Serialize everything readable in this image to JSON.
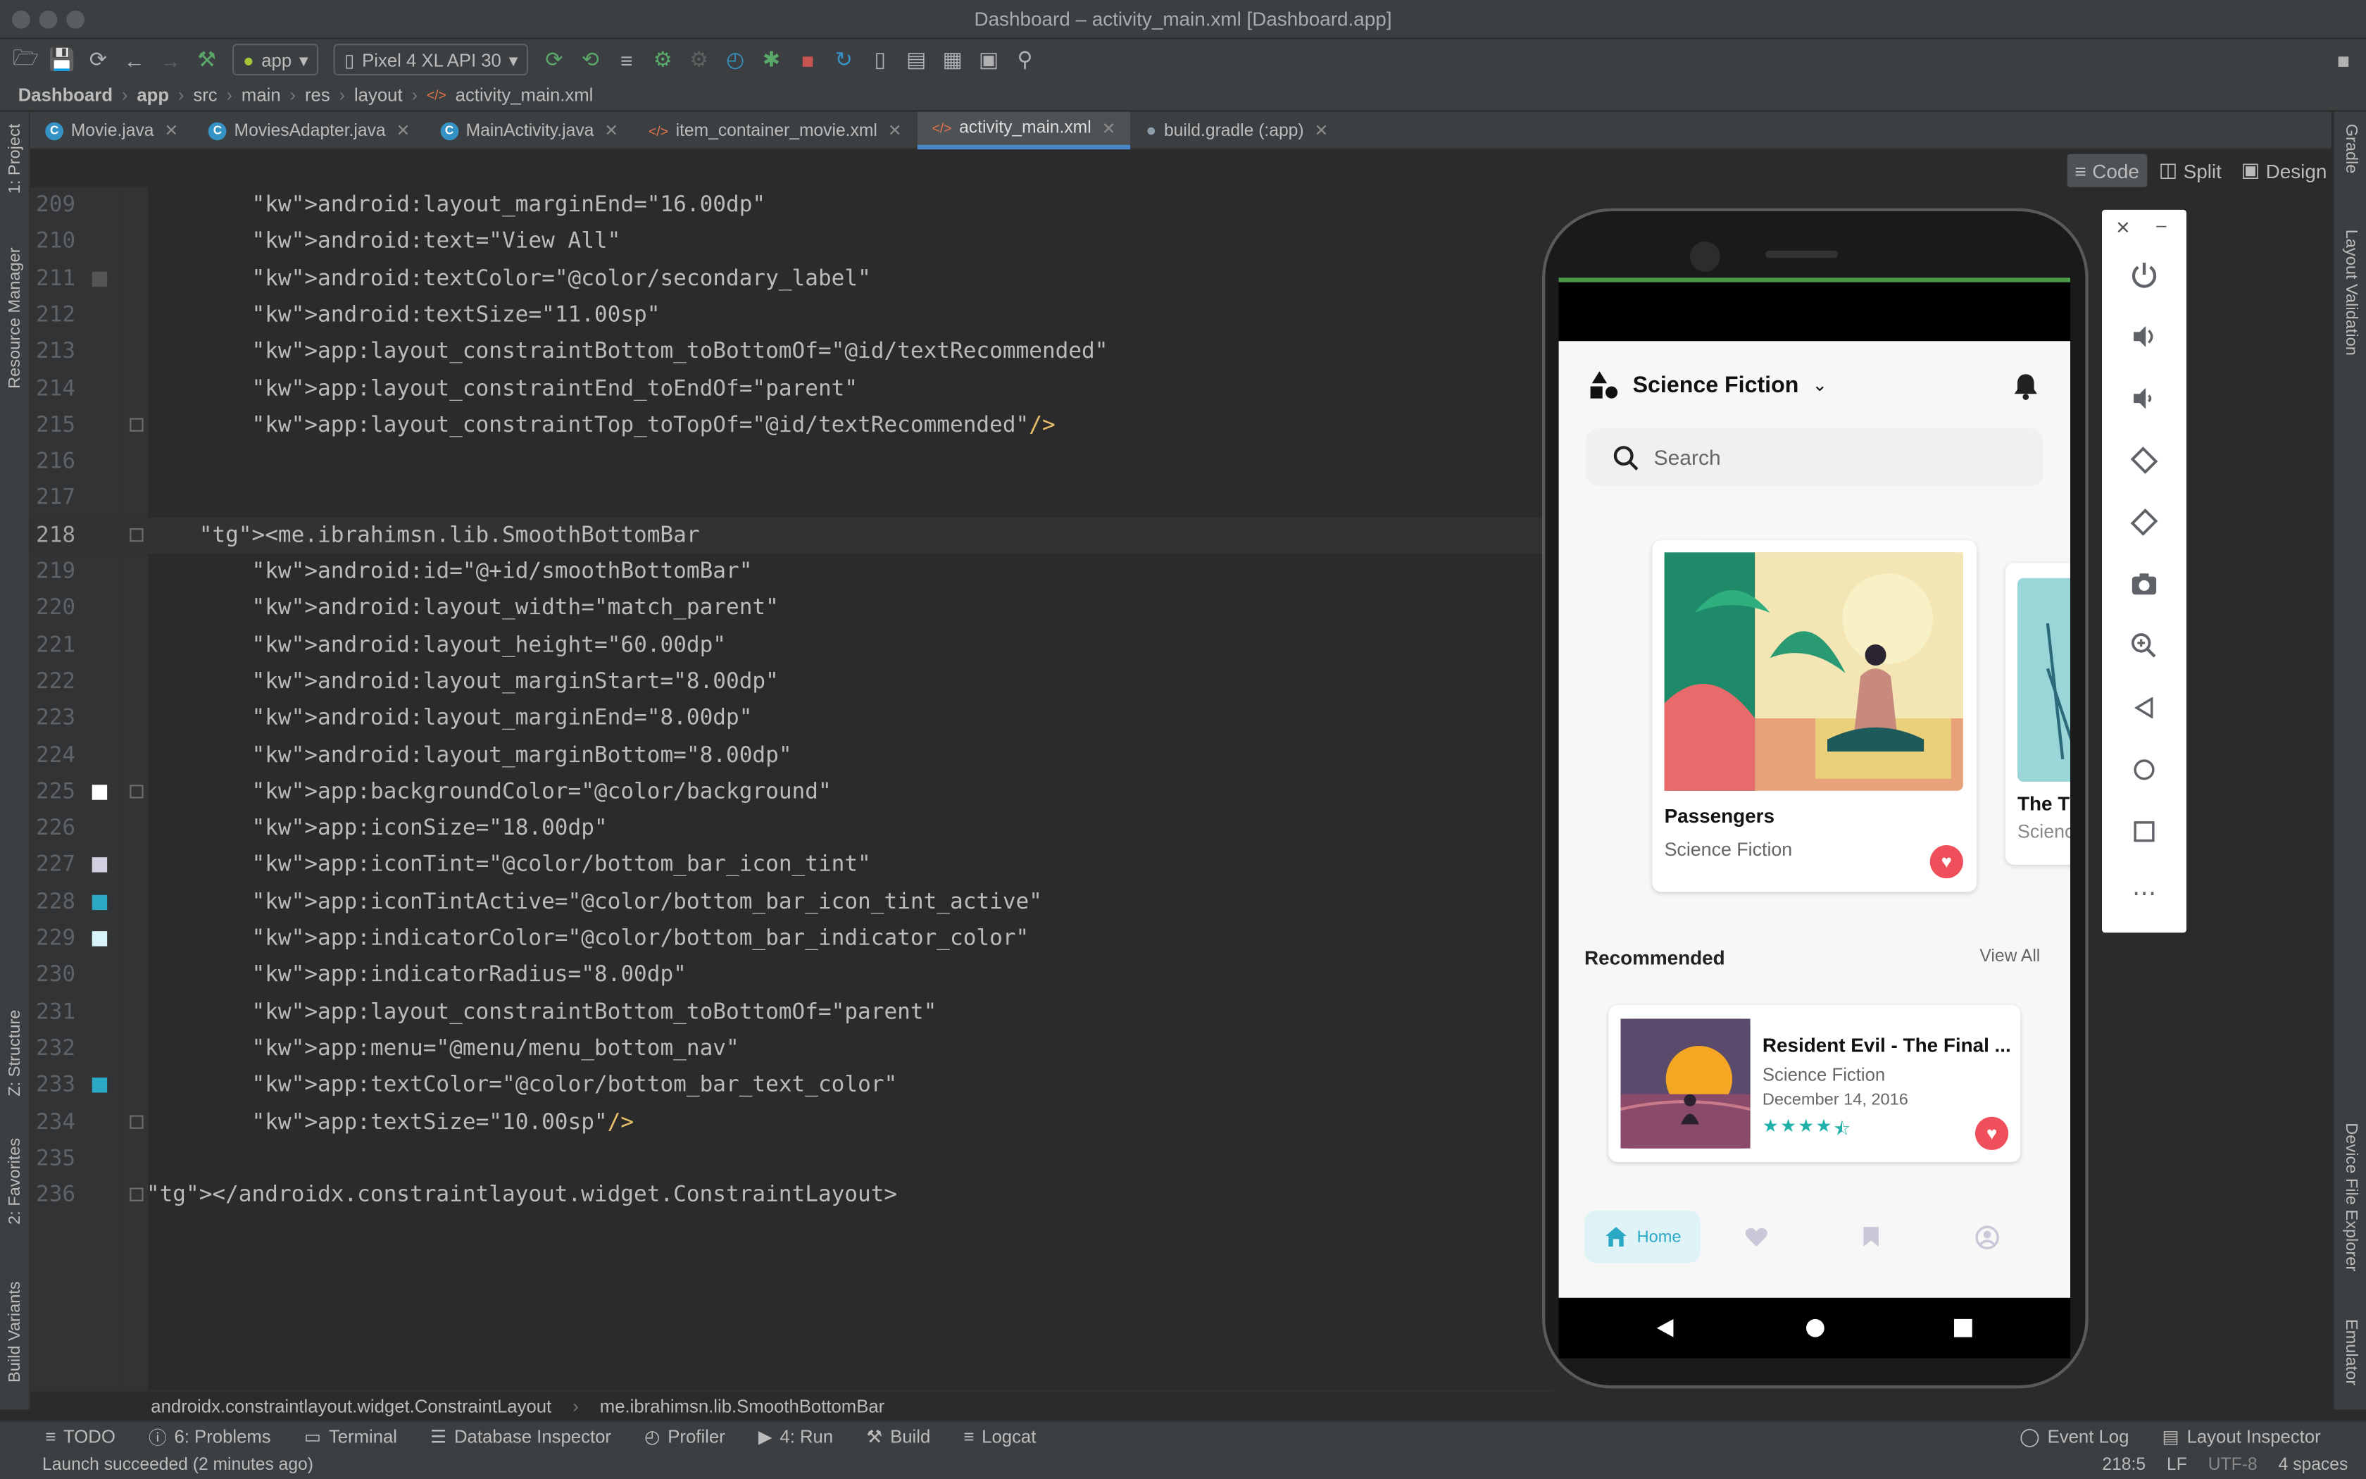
{
  "window": {
    "title": "Dashboard – activity_main.xml [Dashboard.app]"
  },
  "toolbar": {
    "run_config": "app",
    "device": "Pixel 4 XL API 30"
  },
  "breadcrumb": [
    "Dashboard",
    "app",
    "src",
    "main",
    "res",
    "layout",
    "activity_main.xml"
  ],
  "tabs": [
    {
      "label": "Movie.java",
      "icon": "class-icon"
    },
    {
      "label": "MoviesAdapter.java",
      "icon": "class-icon"
    },
    {
      "label": "MainActivity.java",
      "icon": "class-icon"
    },
    {
      "label": "item_container_movie.xml",
      "icon": "xml-icon"
    },
    {
      "label": "activity_main.xml",
      "icon": "xml-icon",
      "active": true
    },
    {
      "label": "build.gradle (:app)",
      "icon": "gradle-icon"
    }
  ],
  "left_strip": [
    "1: Project",
    "Resource Manager",
    "Z: Structure",
    "2: Favorites",
    "Build Variants"
  ],
  "right_strip": [
    "Gradle",
    "Layout Validation",
    "Device File Explorer",
    "Emulator"
  ],
  "view_modes": [
    "Code",
    "Split",
    "Design"
  ],
  "editor": {
    "current_line": "218",
    "lines": [
      {
        "n": "209",
        "text": "        android:layout_marginEnd=\"16.00dp\""
      },
      {
        "n": "210",
        "text": "        android:text=\"View All\""
      },
      {
        "n": "211",
        "text": "        android:textColor=\"@color/secondary_label\"",
        "swatch": "#555555"
      },
      {
        "n": "212",
        "text": "        android:textSize=\"11.00sp\""
      },
      {
        "n": "213",
        "text": "        app:layout_constraintBottom_toBottomOf=\"@id/textRecommended\""
      },
      {
        "n": "214",
        "text": "        app:layout_constraintEnd_toEndOf=\"parent\""
      },
      {
        "n": "215",
        "text": "        app:layout_constraintTop_toTopOf=\"@id/textRecommended\"/>"
      },
      {
        "n": "216",
        "text": ""
      },
      {
        "n": "217",
        "text": ""
      },
      {
        "n": "218",
        "text": "    <me.ibrahimsn.lib.SmoothBottomBar"
      },
      {
        "n": "219",
        "text": "        android:id=\"@+id/smoothBottomBar\""
      },
      {
        "n": "220",
        "text": "        android:layout_width=\"match_parent\""
      },
      {
        "n": "221",
        "text": "        android:layout_height=\"60.00dp\""
      },
      {
        "n": "222",
        "text": "        android:layout_marginStart=\"8.00dp\""
      },
      {
        "n": "223",
        "text": "        android:layout_marginEnd=\"8.00dp\""
      },
      {
        "n": "224",
        "text": "        android:layout_marginBottom=\"8.00dp\""
      },
      {
        "n": "225",
        "text": "        app:backgroundColor=\"@color/background\"",
        "swatch": "#ffffff"
      },
      {
        "n": "226",
        "text": "        app:iconSize=\"18.00dp\""
      },
      {
        "n": "227",
        "text": "        app:iconTint=\"@color/bottom_bar_icon_tint\"",
        "swatch": "#d0d0e0"
      },
      {
        "n": "228",
        "text": "        app:iconTintActive=\"@color/bottom_bar_icon_tint_active\"",
        "swatch": "#2aa8c4"
      },
      {
        "n": "229",
        "text": "        app:indicatorColor=\"@color/bottom_bar_indicator_color\"",
        "swatch": "#d8f4f8"
      },
      {
        "n": "230",
        "text": "        app:indicatorRadius=\"8.00dp\""
      },
      {
        "n": "231",
        "text": "        app:layout_constraintBottom_toBottomOf=\"parent\""
      },
      {
        "n": "232",
        "text": "        app:menu=\"@menu/menu_bottom_nav\""
      },
      {
        "n": "233",
        "text": "        app:textColor=\"@color/bottom_bar_text_color\"",
        "swatch": "#2aa8c4"
      },
      {
        "n": "234",
        "text": "        app:textSize=\"10.00sp\"/>"
      },
      {
        "n": "235",
        "text": ""
      },
      {
        "n": "236",
        "text": "</androidx.constraintlayout.widget.ConstraintLayout>"
      }
    ]
  },
  "editor_breadcrumb": [
    "androidx.constraintlayout.widget.ConstraintLayout",
    "me.ibrahimsn.lib.SmoothBottomBar"
  ],
  "bottom_tools": [
    "TODO",
    "6: Problems",
    "Terminal",
    "Database Inspector",
    "Profiler",
    "4: Run",
    "Build",
    "Logcat"
  ],
  "bottom_tools_right": [
    "Event Log",
    "Layout Inspector"
  ],
  "status": {
    "message": "Launch succeeded (2 minutes ago)",
    "position": "218:5",
    "line_sep": "LF",
    "encoding": "UTF-8",
    "indent": "4 spaces"
  },
  "app": {
    "genre": "Science Fiction",
    "search_placeholder": "Search",
    "featured": [
      {
        "title": "Passengers",
        "genre": "Science Fiction"
      },
      {
        "title": "The T",
        "genre": "Scienc"
      }
    ],
    "recommended_label": "Recommended",
    "view_all": "View All",
    "recommended": {
      "title": "Resident Evil - The Final ...",
      "genre": "Science Fiction",
      "date": "December 14, 2016",
      "rating": 4.5
    },
    "nav": {
      "home": "Home"
    }
  },
  "colors": {
    "accent": "#2aa8c4",
    "heart": "#ee4f5a",
    "indicator": "#dff3f7"
  }
}
